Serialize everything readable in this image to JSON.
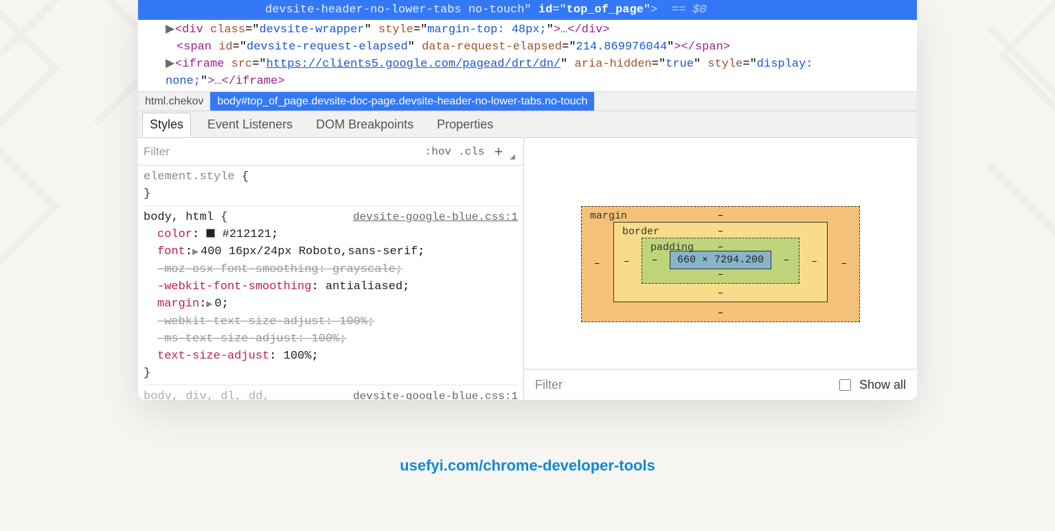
{
  "highlight": {
    "classes": "devsite-header-no-lower-tabs no-touch",
    "id_attr": "id",
    "id_val": "top_of_page",
    "tail": "== $0"
  },
  "dom": {
    "div": {
      "tag": "div",
      "class_attr": "class",
      "class_val": "devsite-wrapper",
      "style_attr": "style",
      "style_val": "margin-top: 48px;",
      "close": "</div>"
    },
    "span": {
      "tag": "span",
      "id_attr": "id",
      "id_val": "devsite-request-elapsed",
      "data_attr": "data-request-elapsed",
      "data_val": "214.869976044",
      "close": "</span>"
    },
    "iframe": {
      "tag": "iframe",
      "src_attr": "src",
      "src_val": "https://clients5.google.com/pagead/drt/dn/",
      "aria_attr": "aria-hidden",
      "aria_val": "true",
      "style_attr": "style",
      "style_val": "display:",
      "style_cont": "none;",
      "close": "</iframe>"
    }
  },
  "breadcrumb": {
    "c0": "html.chekov",
    "c1": "body#top_of_page.devsite-doc-page.devsite-header-no-lower-tabs.no-touch"
  },
  "subtabs": {
    "styles": "Styles",
    "listeners": "Event Listeners",
    "dombp": "DOM Breakpoints",
    "props": "Properties"
  },
  "styles": {
    "filter": "Filter",
    "hov": ":hov",
    "cls": ".cls",
    "elemstyle_sel": "element.style",
    "rule2_sel": "body, html",
    "rule2_src": "devsite-google-blue.css:1",
    "p_color_name": "color",
    "p_color_val": "#212121",
    "p_font_name": "font",
    "p_font_val": "400 16px/24px Roboto,sans-serif",
    "p_moz_name": "-moz-osx-font-smoothing",
    "p_moz_val": "grayscale",
    "p_wk_name": "-webkit-font-smoothing",
    "p_wk_val": "antialiased",
    "p_margin_name": "margin",
    "p_margin_val": "0",
    "p_wkt_name": "-webkit-text-size-adjust",
    "p_wkt_val": "100%",
    "p_mst_name": "-ms-text-size-adjust",
    "p_mst_val": "100%",
    "p_tsa_name": "text-size-adjust",
    "p_tsa_val": "100%",
    "rule3_sel": "body, div, dl, dd,",
    "rule3_src": "devsite-google-blue.css:1"
  },
  "boxmodel": {
    "margin_label": "margin",
    "border_label": "border",
    "padding_label": "padding",
    "dash": "–",
    "content": "660 × 7294.200"
  },
  "computed": {
    "filter": "Filter",
    "showall": "Show all"
  },
  "caption": "usefyi.com/chrome-developer-tools"
}
